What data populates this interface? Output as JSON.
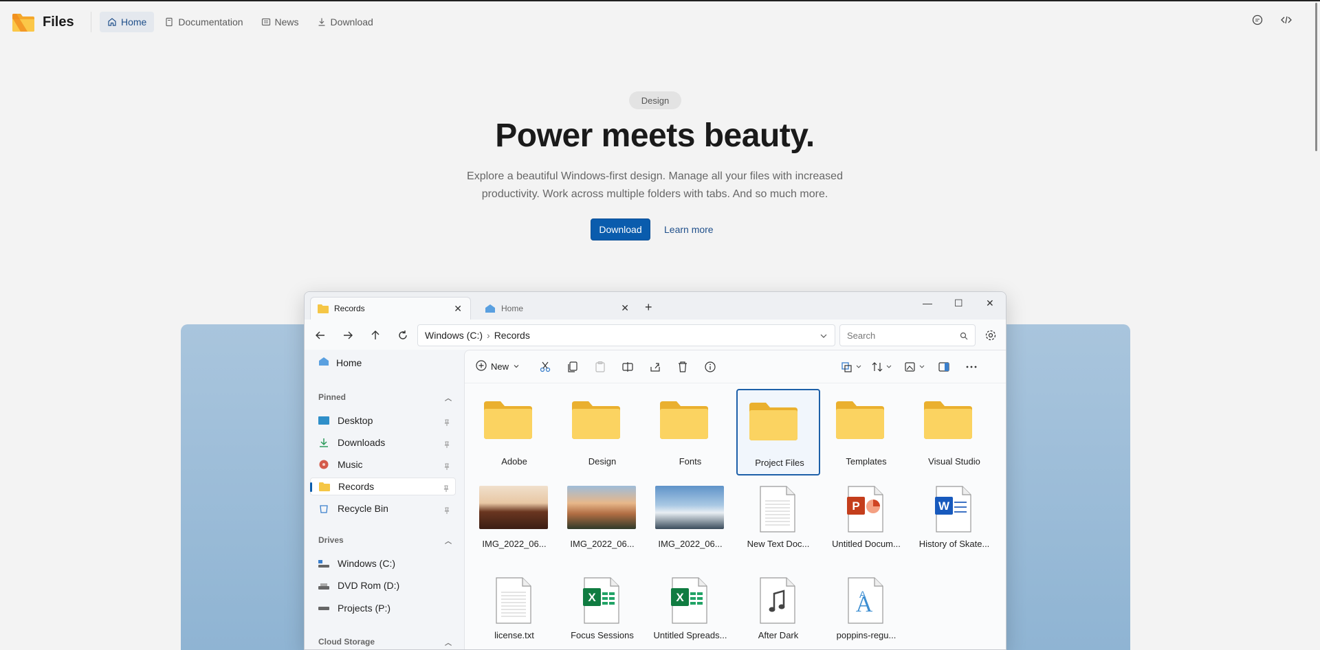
{
  "colors": {
    "accent": "#0a5cad",
    "folder": "#f5c646",
    "backdrop": "#a9c5dd"
  },
  "nav": {
    "brand": "Files",
    "links": [
      {
        "label": "Home",
        "icon": "home-icon",
        "active": true
      },
      {
        "label": "Documentation",
        "icon": "book-icon",
        "active": false
      },
      {
        "label": "News",
        "icon": "news-icon",
        "active": false
      },
      {
        "label": "Download",
        "icon": "download-icon",
        "active": false
      }
    ],
    "right_icons": [
      "chat-icon",
      "code-icon"
    ]
  },
  "hero": {
    "chip": "Design",
    "title": "Power meets beauty.",
    "description": "Explore a beautiful Windows-first design. Manage all your files with increased productivity. Work across multiple folders with tabs. And so much more.",
    "primary_button": "Download",
    "secondary_link": "Learn more"
  },
  "app": {
    "tabs": [
      {
        "label": "Records",
        "active": true
      },
      {
        "label": "Home",
        "active": false
      }
    ],
    "address": {
      "drive": "Windows (C:)",
      "folder": "Records"
    },
    "search_placeholder": "Search",
    "sidebar": {
      "home": "Home",
      "pinned_title": "Pinned",
      "pinned": [
        {
          "label": "Desktop",
          "icon": "desktop-icon"
        },
        {
          "label": "Downloads",
          "icon": "downloads-icon"
        },
        {
          "label": "Music",
          "icon": "music-icon"
        },
        {
          "label": "Records",
          "icon": "folder-icon",
          "selected": true
        },
        {
          "label": "Recycle Bin",
          "icon": "recycle-bin-icon"
        }
      ],
      "drives_title": "Drives",
      "drives": [
        {
          "label": "Windows (C:)",
          "icon": "drive-icon"
        },
        {
          "label": "DVD Rom (D:)",
          "icon": "dvd-icon"
        },
        {
          "label": "Projects (P:)",
          "icon": "drive-icon"
        }
      ],
      "cloud_title": "Cloud Storage"
    },
    "toolbar": {
      "new_label": "New"
    },
    "items": [
      {
        "label": "Adobe",
        "kind": "folder"
      },
      {
        "label": "Design",
        "kind": "folder"
      },
      {
        "label": "Fonts",
        "kind": "folder"
      },
      {
        "label": "Project Files",
        "kind": "folder",
        "selected": true
      },
      {
        "label": "Templates",
        "kind": "folder"
      },
      {
        "label": "Visual Studio",
        "kind": "folder"
      },
      {
        "label": "IMG_2022_06...",
        "kind": "image"
      },
      {
        "label": "IMG_2022_06...",
        "kind": "image"
      },
      {
        "label": "IMG_2022_06...",
        "kind": "image"
      },
      {
        "label": "New Text Doc...",
        "kind": "text"
      },
      {
        "label": "Untitled Docum...",
        "kind": "powerpoint"
      },
      {
        "label": "History of Skate...",
        "kind": "word"
      },
      {
        "label": "license.txt",
        "kind": "text"
      },
      {
        "label": "Focus Sessions",
        "kind": "excel"
      },
      {
        "label": "Untitled Spreads...",
        "kind": "excel"
      },
      {
        "label": "After Dark",
        "kind": "music"
      },
      {
        "label": "poppins-regu...",
        "kind": "font"
      }
    ]
  }
}
